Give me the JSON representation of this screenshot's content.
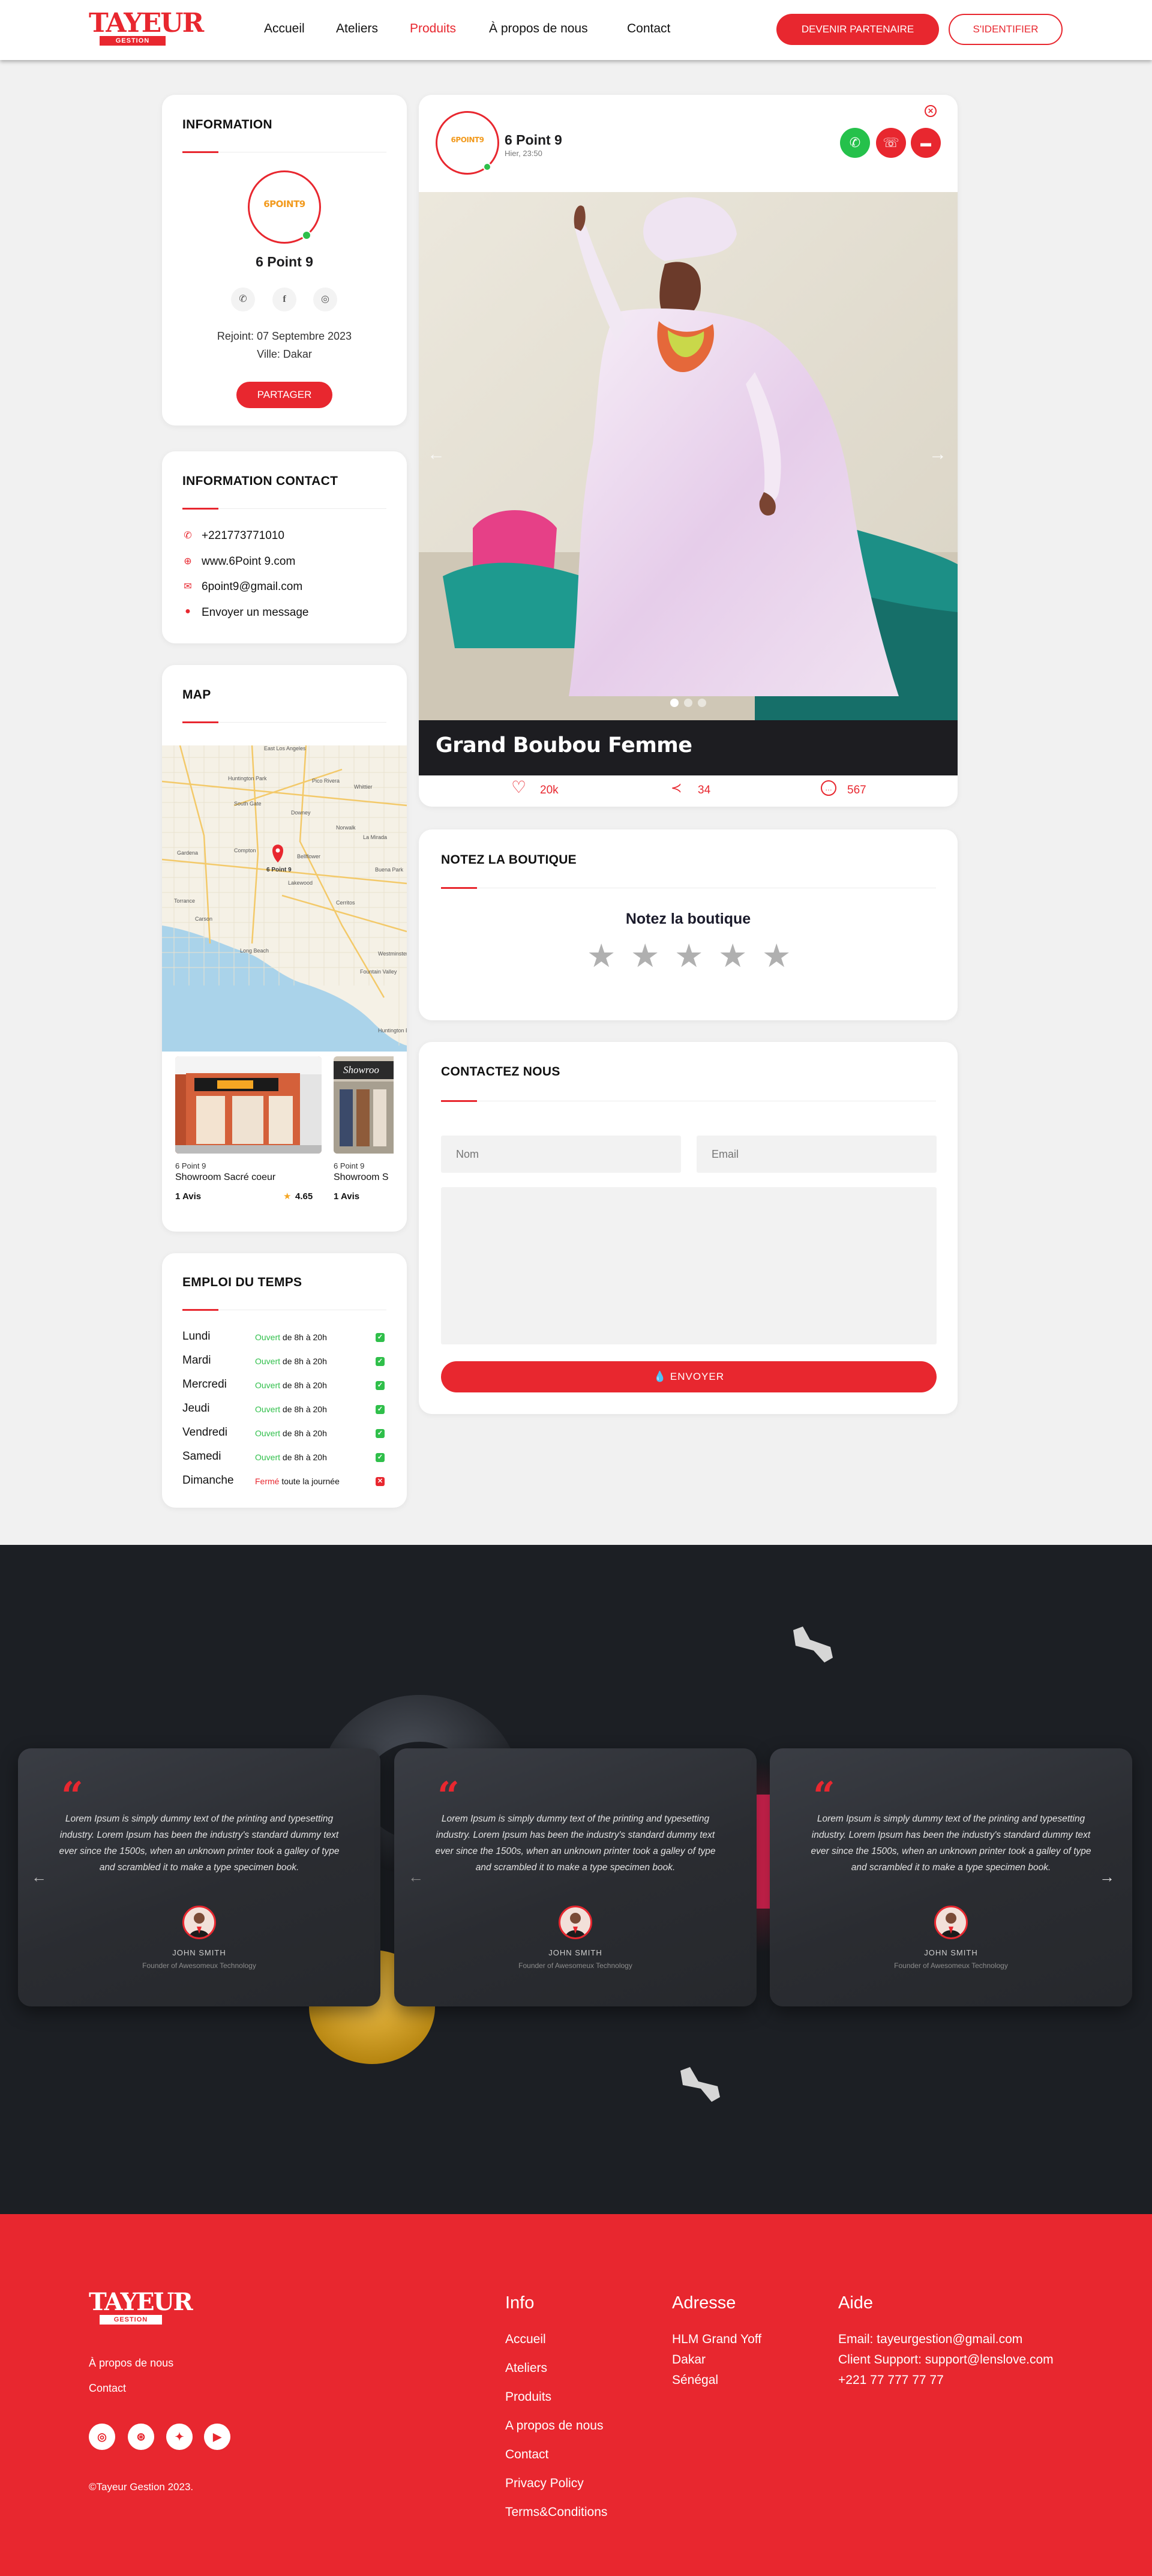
{
  "header": {
    "logo_main": "TAYEUR",
    "logo_sub": "GESTION",
    "nav": [
      "Accueil",
      "Ateliers",
      "Produits",
      "À propos de nous",
      "Contact"
    ],
    "active_nav": "Produits",
    "partner_button": "DEVENIR PARTENAIRE",
    "login_button": "S'IDENTIFIER"
  },
  "info_card": {
    "title": "INFORMATION",
    "shop_name": "6 Point 9",
    "avatar_text": "6POINT9",
    "joined": "Rejoint: 07 Septembre 2023",
    "city": "Ville: Dakar",
    "share_button": "PARTAGER",
    "social_icons": [
      "phone-icon",
      "facebook-icon",
      "instagram-icon"
    ]
  },
  "contact_info": {
    "title": "INFORMATION CONTACT",
    "phone": "+221773771010",
    "website": "www.6Point 9.com",
    "email": "6point9@gmail.com",
    "message": "Envoyer un message"
  },
  "map_card": {
    "title": "MAP",
    "place_labels": [
      "East Los Angeles",
      "Huntington Park",
      "Pico Rivera",
      "Whittier",
      "South Gate",
      "Downey",
      "Compton",
      "Bellflower",
      "La Mirada",
      "Buena Park",
      "Lakewood",
      "Cerritos",
      "Gardena",
      "Torrance",
      "Carson",
      "Long Beach",
      "Westminster",
      "Fountain Valley",
      "Huntington Beach",
      "Norwalk"
    ],
    "marker_label": "6 Point 9",
    "showrooms": [
      {
        "brand": "6 Point 9",
        "name": "Showroom Sacré coeur",
        "reviews": "1 Avis",
        "rating": "4.65"
      },
      {
        "brand": "6 Point 9",
        "name": "Showroom S",
        "reviews": "1 Avis",
        "rating": ""
      }
    ]
  },
  "schedule": {
    "title": "EMPLOI DU TEMPS",
    "days": [
      {
        "day": "Lundi",
        "status": "Ouvert",
        "hours": "de 8h à 20h",
        "open": true
      },
      {
        "day": "Mardi",
        "status": "Ouvert",
        "hours": "de 8h à 20h",
        "open": true
      },
      {
        "day": "Mercredi",
        "status": "Ouvert",
        "hours": "de 8h à 20h",
        "open": true
      },
      {
        "day": "Jeudi",
        "status": "Ouvert",
        "hours": "de 8h à 20h",
        "open": true
      },
      {
        "day": "Vendredi",
        "status": "Ouvert",
        "hours": "de 8h à 20h",
        "open": true
      },
      {
        "day": "Samedi",
        "status": "Ouvert",
        "hours": "de 8h à 20h",
        "open": true
      },
      {
        "day": "Dimanche",
        "status": "Fermé",
        "hours": "toute la journée",
        "open": false
      }
    ]
  },
  "post": {
    "shop_name": "6 Point 9",
    "time": "Hier, 23:50",
    "product_title": "Grand Boubou Femme",
    "likes": "20k",
    "shares": "34",
    "comments": "567",
    "slide_count": 3,
    "active_slide": 1
  },
  "rating": {
    "title": "NOTEZ LA BOUTIQUE",
    "subtitle": "Notez la boutique",
    "stars": 5,
    "current": 0
  },
  "contact_form": {
    "title": "CONTACTEZ NOUS",
    "name_placeholder": "Nom",
    "email_placeholder": "Email",
    "send_button": "ENVOYER"
  },
  "testimonials": [
    {
      "quote": "Lorem Ipsum is simply dummy text of the printing and typesetting industry. Lorem Ipsum has been the industry's standard dummy text ever since the 1500s, when an unknown printer took a galley of type and scrambled it to make a type specimen book.",
      "name": "JOHN SMITH",
      "role": "Founder of Awesomeux Technology"
    },
    {
      "quote": "Lorem Ipsum is simply dummy text of the printing and typesetting industry. Lorem Ipsum has been the industry's standard dummy text ever since the 1500s, when an unknown printer took a galley of type and scrambled it to make a type specimen book.",
      "name": "JOHN SMITH",
      "role": "Founder of Awesomeux Technology"
    },
    {
      "quote": "Lorem Ipsum is simply dummy text of the printing and typesetting industry. Lorem Ipsum has been the industry's standard dummy text ever since the 1500s, when an unknown printer took a galley of type and scrambled it to make a type specimen book.",
      "name": "JOHN SMITH",
      "role": "Founder of Awesomeux Technology"
    }
  ],
  "footer": {
    "about": "À propos de nous",
    "contact": "Contact",
    "copyright": "©Tayeur Gestion 2023.",
    "info_title": "Info",
    "info_links": [
      "Accueil",
      "Ateliers",
      "Produits",
      "A propos de nous",
      "Contact",
      "Privacy Policy",
      "Terms&Conditions"
    ],
    "address_title": "Adresse",
    "address_lines": [
      "HLM Grand Yoff",
      "Dakar",
      "Sénégal"
    ],
    "help_title": "Aide",
    "help_lines": [
      "Email: tayeurgestion@gmail.com",
      "Client Support: support@lenslove.com",
      "+221 77 777 77 77"
    ]
  },
  "colors": {
    "accent": "#e8272f",
    "open": "#2fbf4a",
    "dark": "#1c1f24",
    "whatsapp": "#25c14b"
  }
}
